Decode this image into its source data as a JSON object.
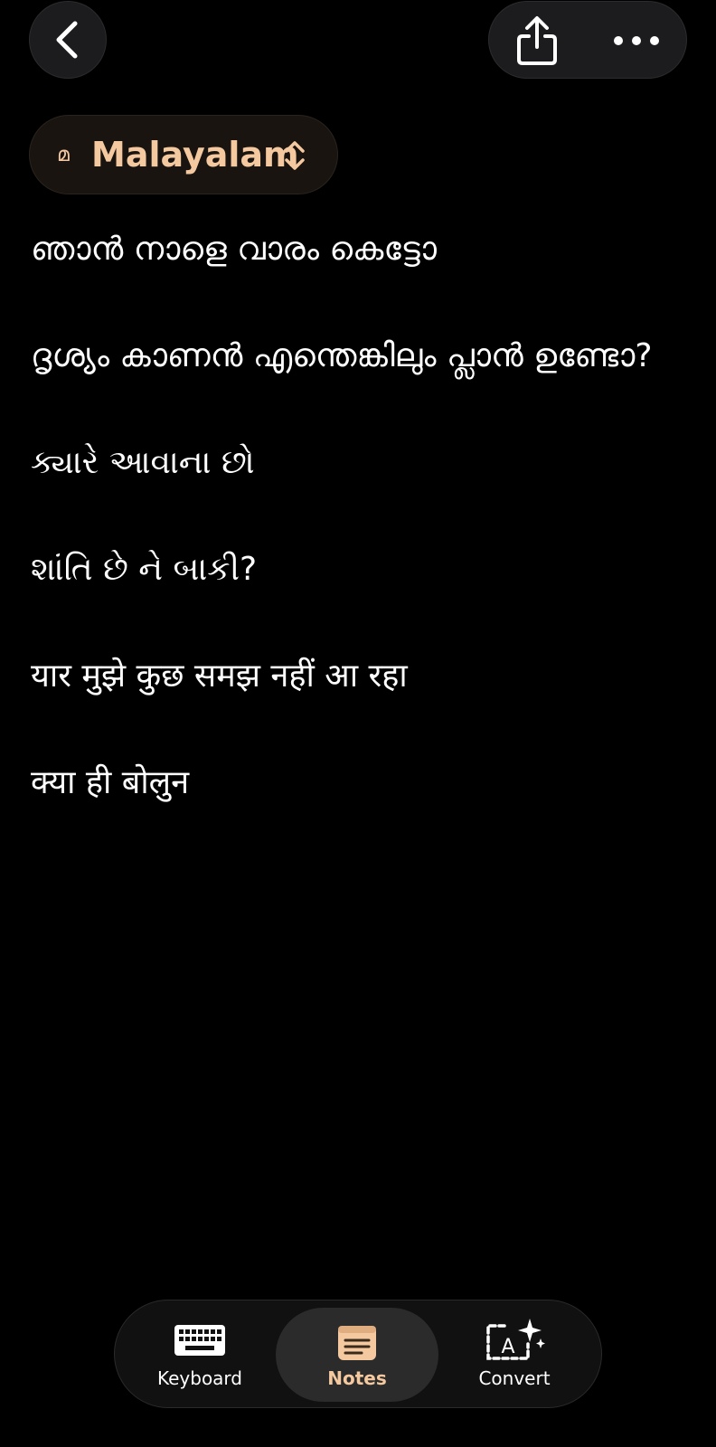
{
  "header": {
    "back_icon": "chevron-left-icon",
    "share_icon": "share-icon",
    "more_icon": "more-horizontal-icon"
  },
  "language": {
    "glyph": "മ",
    "label": "Malayalam",
    "chevron_icon": "chevron-up-down-icon",
    "accent_color": "#f5c9a0"
  },
  "notes": [
    "ഞാൻ നാളെ വാരം കെട്ടോ",
    "ദൃശ്യം കാണൻ എന്തെങ്കിലും പ്ലാൻ ഉണ്ടോ?",
    "ક્યારે આવાના છો",
    "શાંતિ છે ને બાકી?",
    "यार मुझे कुछ समझ नहीं आ रहा",
    "क्या ही बोलुन"
  ],
  "tabbar": {
    "tabs": [
      {
        "label": "Keyboard",
        "icon": "keyboard-icon"
      },
      {
        "label": "Notes",
        "icon": "notes-icon",
        "selected": true
      },
      {
        "label": "Convert",
        "icon": "convert-sparkle-icon"
      }
    ]
  }
}
